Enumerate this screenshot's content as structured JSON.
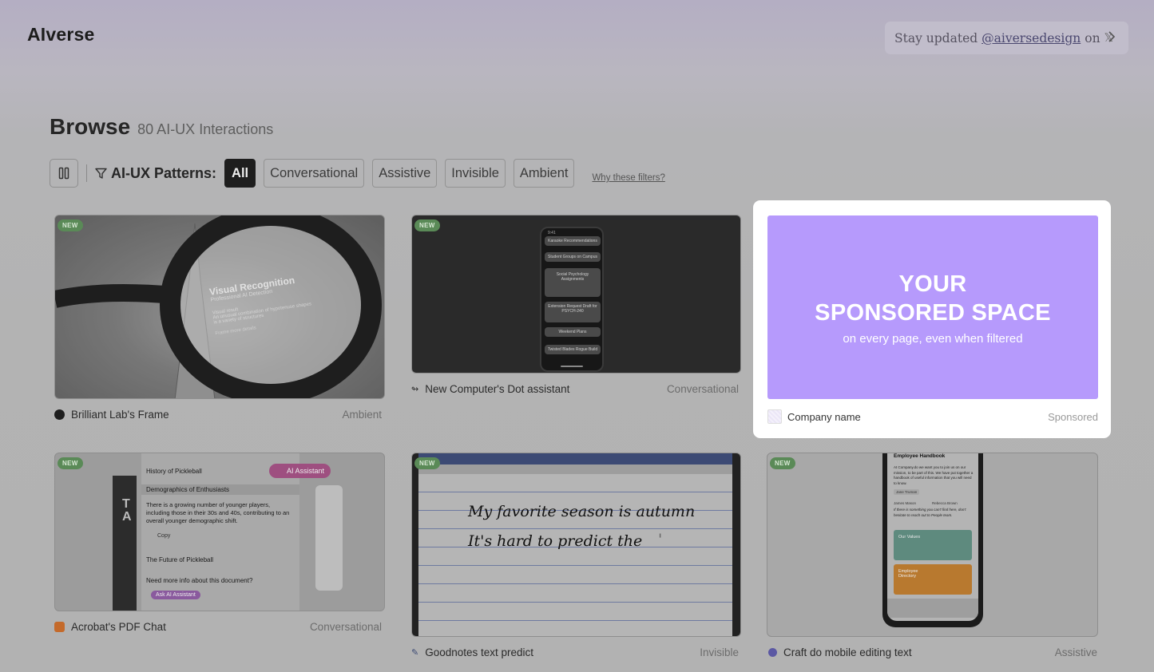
{
  "brand": {
    "logo": "AIverse"
  },
  "stay": {
    "prefix": "Stay updated",
    "handle": "@aiversedesign",
    "suffix": "on",
    "x_glyph": "𝕏"
  },
  "browse": {
    "title": "Browse",
    "count": "80 AI-UX Interactions"
  },
  "filters": {
    "label": "AI-UX Patterns:",
    "chips": [
      "All",
      "Conversational",
      "Assistive",
      "Invisible",
      "Ambient"
    ],
    "active": "All",
    "why": "Why these filters?"
  },
  "cards": [
    {
      "name": "Brilliant Lab's Frame",
      "category": "Ambient",
      "badge": "NEW",
      "thumb_text": {
        "title": "Visual Recognition",
        "sub": "Professional AI Detection",
        "l1": "Visual result",
        "l2": "An unusual combination of hypotenuse shapes",
        "l3": "is a variety of structures",
        "l4": "Frame more details"
      }
    },
    {
      "name": "New Computer's Dot assistant",
      "category": "Conversational",
      "badge": "NEW",
      "thumb_text": {
        "time": "9:41",
        "items": [
          "Karaoke Recommendations",
          "Student Groups on Campus",
          "Social Psychology Assignments",
          "Extension Request Draft for PSYCH-240",
          "Weekend Plans",
          "Twisted Blades Rogue Build"
        ]
      }
    },
    {
      "name": "Acrobat's PDF Chat",
      "category": "Conversational",
      "badge": "NEW",
      "thumb_text": {
        "h1": "History of Pickleball",
        "h2": "Demographics of Enthusiasts",
        "body": "There is a growing number of younger players, including those in their 30s and 40s, contributing to an overall younger demographic shift.",
        "copy": "Copy",
        "h3": "The Future of Pickleball",
        "q": "Need more info about this document?",
        "btn": "Ask AI Assistant",
        "pill": "AI Assistant"
      }
    },
    {
      "name": "Goodnotes text predict",
      "category": "Invisible",
      "badge": "NEW",
      "thumb_text": {
        "line1": "My favorite season is autumn",
        "line2": "It's hard to predict the",
        "line3": "'"
      }
    },
    {
      "name": "Craft do mobile editing text",
      "category": "Assistive",
      "badge": "NEW",
      "thumb_text": {
        "title": "Employee Handbook",
        "body": "At Company.do we want you to join us on our mission, to be part of this. We have put together a handbook of useful information that you will need to know.",
        "tag1": "Jane Truman",
        "tag2": "James Mason",
        "tag3": "Rebecca Brown",
        "body2": "If there is something you can't find here, don't hesitate to reach out to People team.",
        "card1": "Our Values",
        "card2": "Employee Directory"
      }
    }
  ],
  "sponsor": {
    "line1": "YOUR",
    "line2": "SPONSORED SPACE",
    "line3": "on every page, even when filtered",
    "company": "Company name",
    "label": "Sponsored"
  },
  "colors": {
    "sponsor_purple": "#b69afc",
    "badge_green": "#5a8a57",
    "active_chip": "#1e1e1e"
  }
}
